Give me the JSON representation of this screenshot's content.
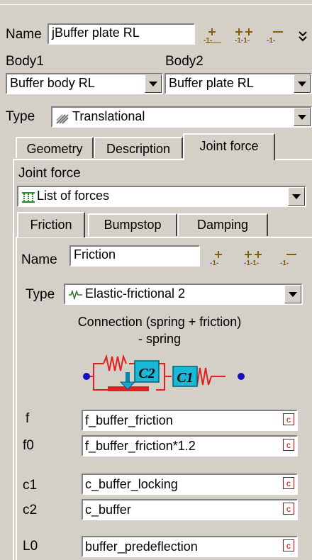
{
  "header": {
    "name_label": "Name",
    "name_value": "jBuffer plate RL"
  },
  "bodies": {
    "body1_label": "Body1",
    "body2_label": "Body2",
    "body1_value": "Buffer body RL",
    "body2_value": "Buffer plate RL"
  },
  "joint_type": {
    "label": "Type",
    "value": "Translational"
  },
  "tabs": [
    {
      "label": "Geometry"
    },
    {
      "label": "Description"
    },
    {
      "label": "Joint force"
    }
  ],
  "joint_force": {
    "label": "Joint force",
    "value": "List of forces"
  },
  "subtabs": [
    {
      "label": "Friction"
    },
    {
      "label": "Bumpstop"
    },
    {
      "label": "Damping"
    }
  ],
  "force": {
    "name_label": "Name",
    "name_value": "Friction",
    "type_label": "Type",
    "type_value": "Elastic-frictional 2",
    "caption_line1": "Connection (spring + friction)",
    "caption_line2": "- spring",
    "diagram_c2": "C2",
    "diagram_c1": "C1"
  },
  "params": [
    {
      "label": "f",
      "value": "f_buffer_friction"
    },
    {
      "label": "f0",
      "value": "f_buffer_friction*1.2"
    },
    {
      "label": "c1",
      "value": "c_buffer_locking"
    },
    {
      "label": "c2",
      "value": "c_buffer"
    },
    {
      "label": "L0",
      "value": "buffer_predeflection"
    }
  ],
  "c_button_label": "c",
  "icons": [
    "add-element-icon",
    "copy-element-icon",
    "delete-element-icon",
    "more-icon",
    "joint-type-icon",
    "force-list-icon",
    "force-type-icon"
  ],
  "colors": {
    "face": "#d4d0c8",
    "field": "#ffffff",
    "spring": "#e02020",
    "accent": "#1d9dc7",
    "node": "#1010c0"
  }
}
